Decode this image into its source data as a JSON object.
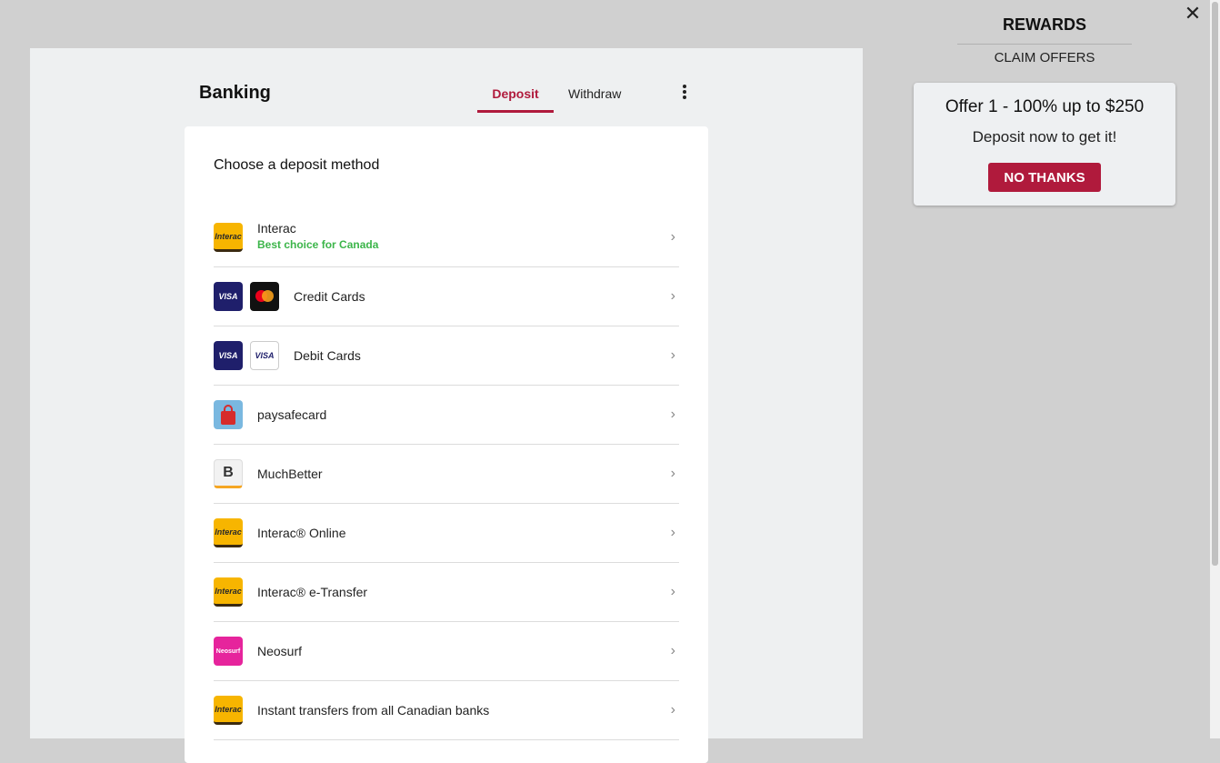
{
  "banking": {
    "title": "Banking",
    "tabs": {
      "deposit": "Deposit",
      "withdraw": "Withdraw"
    },
    "active_tab": "deposit",
    "heading": "Choose a deposit method",
    "methods": [
      {
        "name": "Interac",
        "subtitle": "Best choice for Canada",
        "logos": [
          "Interac"
        ]
      },
      {
        "name": "Credit Cards",
        "logos": [
          "VISA",
          "mastercard"
        ]
      },
      {
        "name": "Debit Cards",
        "logos": [
          "VISA",
          "VISA Debit"
        ]
      },
      {
        "name": "paysafecard",
        "logos": [
          "paysafecard"
        ]
      },
      {
        "name": "MuchBetter",
        "logos": [
          "MuchBetter"
        ]
      },
      {
        "name": "Interac® Online",
        "logos": [
          "Interac"
        ]
      },
      {
        "name": "Interac® e-Transfer",
        "logos": [
          "Interac"
        ]
      },
      {
        "name": "Neosurf",
        "logos": [
          "Neosurf"
        ]
      },
      {
        "name": "Instant transfers from all Canadian banks",
        "logos": [
          "Interac"
        ]
      }
    ],
    "logo_text": {
      "interac": "Interac",
      "visa": "VISA",
      "neosurf": "Neosurf",
      "muchbetter": "B"
    }
  },
  "rewards": {
    "title": "REWARDS",
    "claim_offers": "CLAIM OFFERS",
    "offer_title": "Offer 1 - 100% up to $250",
    "offer_subtitle": "Deposit now to get it!",
    "no_thanks": "NO THANKS"
  },
  "icons": {
    "close": "close-icon",
    "menu": "more-vertical-icon",
    "chevron": "chevron-right-icon"
  },
  "colors": {
    "accent": "#b01a3c",
    "success": "#3cb54a",
    "overlay": "#d0d0d0"
  }
}
